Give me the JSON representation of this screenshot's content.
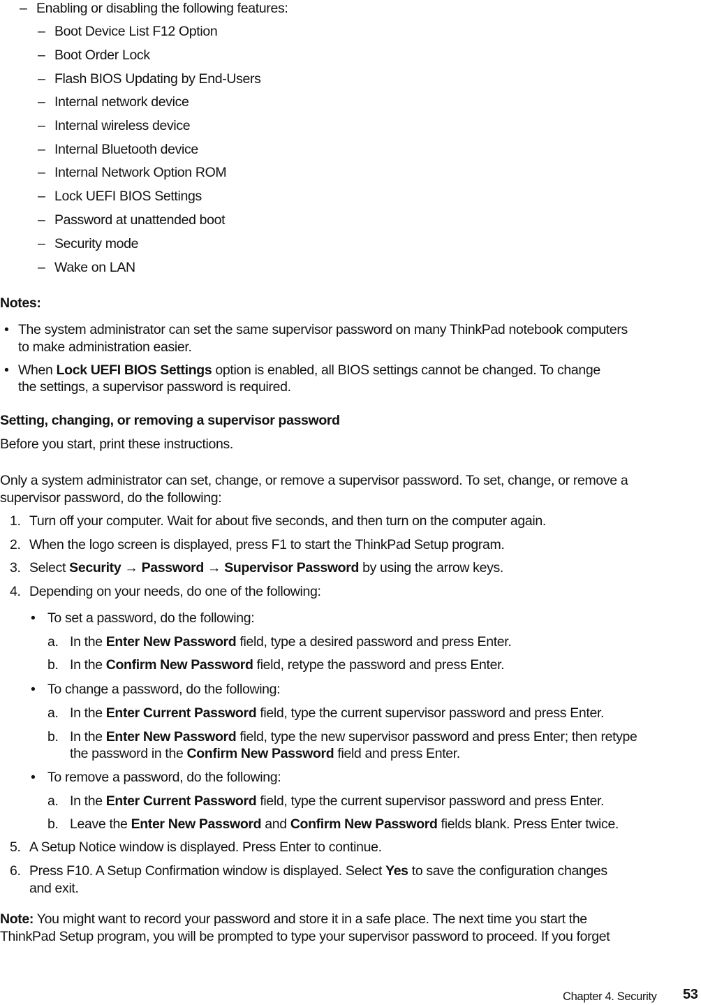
{
  "features_intro": "Enabling or disabling the following features:",
  "features": [
    "Boot Device List F12 Option",
    "Boot Order Lock",
    "Flash BIOS Updating by End-Users",
    "Internal network device",
    "Internal wireless device",
    "Internal Bluetooth device",
    "Internal Network Option ROM",
    "Lock UEFI BIOS Settings",
    "Password at unattended boot",
    "Security mode",
    "Wake on LAN"
  ],
  "notes": {
    "heading": "Notes:",
    "note1_line1": "The system administrator can set the same supervisor password on many ThinkPad notebook computers",
    "note1_line2": "to make administration easier.",
    "note2_pre": "When ",
    "note2_bold": "Lock UEFI BIOS Settings",
    "note2_post": " option is enabled, all BIOS settings cannot be changed.  To change",
    "note2_line2": "the settings, a supervisor password is required."
  },
  "section": {
    "heading": "Setting, changing, or removing a supervisor password",
    "before": "Before you start, print these instructions.",
    "intro_line1": "Only a system administrator can set, change, or remove a supervisor password. To set, change, or remove a",
    "intro_line2": "supervisor password, do the following:"
  },
  "steps": {
    "s1_num": "1.",
    "s1": "Turn off your computer.  Wait for about five seconds, and then turn on the computer again.",
    "s2_num": "2.",
    "s2": "When the logo screen is displayed, press F1 to start the ThinkPad Setup program.",
    "s3_num": "3.",
    "s3_pre": "Select ",
    "s3_b1": "Security",
    "s3_arrow1": " → ",
    "s3_b2": "Password",
    "s3_arrow2": " → ",
    "s3_b3": "Supervisor Password",
    "s3_post": " by using the arrow keys.",
    "s4_num": "4.",
    "s4": "Depending on your needs, do one of the following:",
    "set_bullet": "To set a password, do the following:",
    "set_a_pre": "In the ",
    "set_a_bold": "Enter New Password",
    "set_a_post": " field, type a desired password and press Enter.",
    "set_b_pre": "In the ",
    "set_b_bold": "Confirm New Password",
    "set_b_post": " field, retype the password and press Enter.",
    "change_bullet": "To change a password, do the following:",
    "change_a_pre": "In the ",
    "change_a_bold": "Enter Current Password",
    "change_a_post": " field, type the current supervisor password and press Enter.",
    "change_b_pre": "In the ",
    "change_b_bold": "Enter New Password",
    "change_b_post": " field, type the new supervisor password and press Enter; then retype",
    "change_b_l2_pre": "the password in the ",
    "change_b_l2_bold": "Confirm New Password",
    "change_b_l2_post": " field and press Enter.",
    "remove_bullet": "To remove a password, do the following:",
    "remove_a_pre": "In the ",
    "remove_a_bold": "Enter Current Password",
    "remove_a_post": " field, type the current supervisor password and press Enter.",
    "remove_b_pre": "Leave the ",
    "remove_b_bold1": "Enter New Password",
    "remove_b_mid": " and ",
    "remove_b_bold2": "Confirm New Password",
    "remove_b_post": " fields blank.  Press Enter twice.",
    "s5_num": "5.",
    "s5": "A Setup Notice window is displayed.  Press Enter to continue.",
    "s6_num": "6.",
    "s6_pre": "Press F10.  A Setup Confirmation window is displayed.  Select ",
    "s6_bold": "Yes",
    "s6_post": " to save the configuration changes",
    "s6_line2": "and exit.",
    "letter_a": "a.",
    "letter_b": "b.",
    "bullet": "•",
    "dash": "–"
  },
  "final_note": {
    "label": "Note:",
    "line1": " You might want to record your password and store it in a safe place.  The next time you start the",
    "line2": "ThinkPad Setup program, you will be prompted to type your supervisor password to proceed.  If you forget"
  },
  "footer": {
    "chapter": "Chapter 4.  Security",
    "page": "53"
  }
}
